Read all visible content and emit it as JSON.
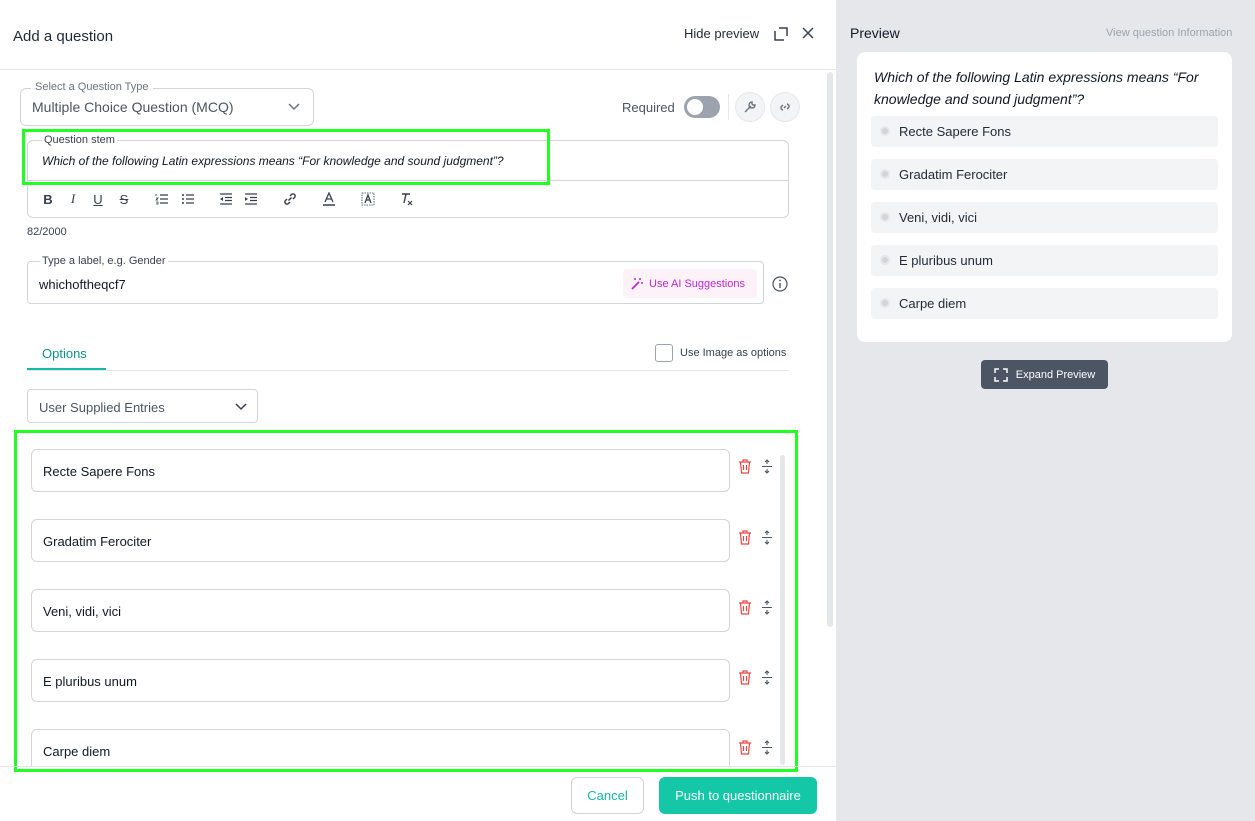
{
  "header": {
    "title": "Add a question",
    "hide_preview_label": "Hide preview"
  },
  "question_type": {
    "legend": "Select a Question Type",
    "value": "Multiple Choice Question (MCQ)"
  },
  "required": {
    "label": "Required",
    "enabled": false
  },
  "stem": {
    "legend": "Question stem",
    "text": "Which of the following Latin expressions means “For knowledge and sound judgment”?",
    "count": "82/2000"
  },
  "label_field": {
    "legend": "Type a label, e.g. Gender",
    "value": "whichoftheqcf7",
    "ai_button": "Use AI Suggestions"
  },
  "options_tab": {
    "tab_label": "Options",
    "use_image_label": "Use Image as options",
    "entries_select": "User Supplied Entries",
    "items": [
      {
        "label": "Recte Sapere Fons"
      },
      {
        "label": "Gradatim Ferociter"
      },
      {
        "label": "Veni, vidi, vici"
      },
      {
        "label": "E pluribus unum"
      },
      {
        "label": "Carpe diem"
      }
    ]
  },
  "footer": {
    "cancel_label": "Cancel",
    "push_label": "Push to questionnaire"
  },
  "preview": {
    "title": "Preview",
    "info_link": "View question Information",
    "question": "Which of the following Latin expressions means “For knowledge and sound judgment”?",
    "options": [
      "Recte Sapere Fons",
      "Gradatim Ferociter",
      "Veni, vidi, vici",
      "E pluribus unum",
      "Carpe diem"
    ],
    "expand_label": "Expand Preview"
  },
  "colors": {
    "accent": "#14c7a6",
    "highlight": "#22ff22",
    "ai": "#c026d3",
    "danger": "#ef4444"
  }
}
